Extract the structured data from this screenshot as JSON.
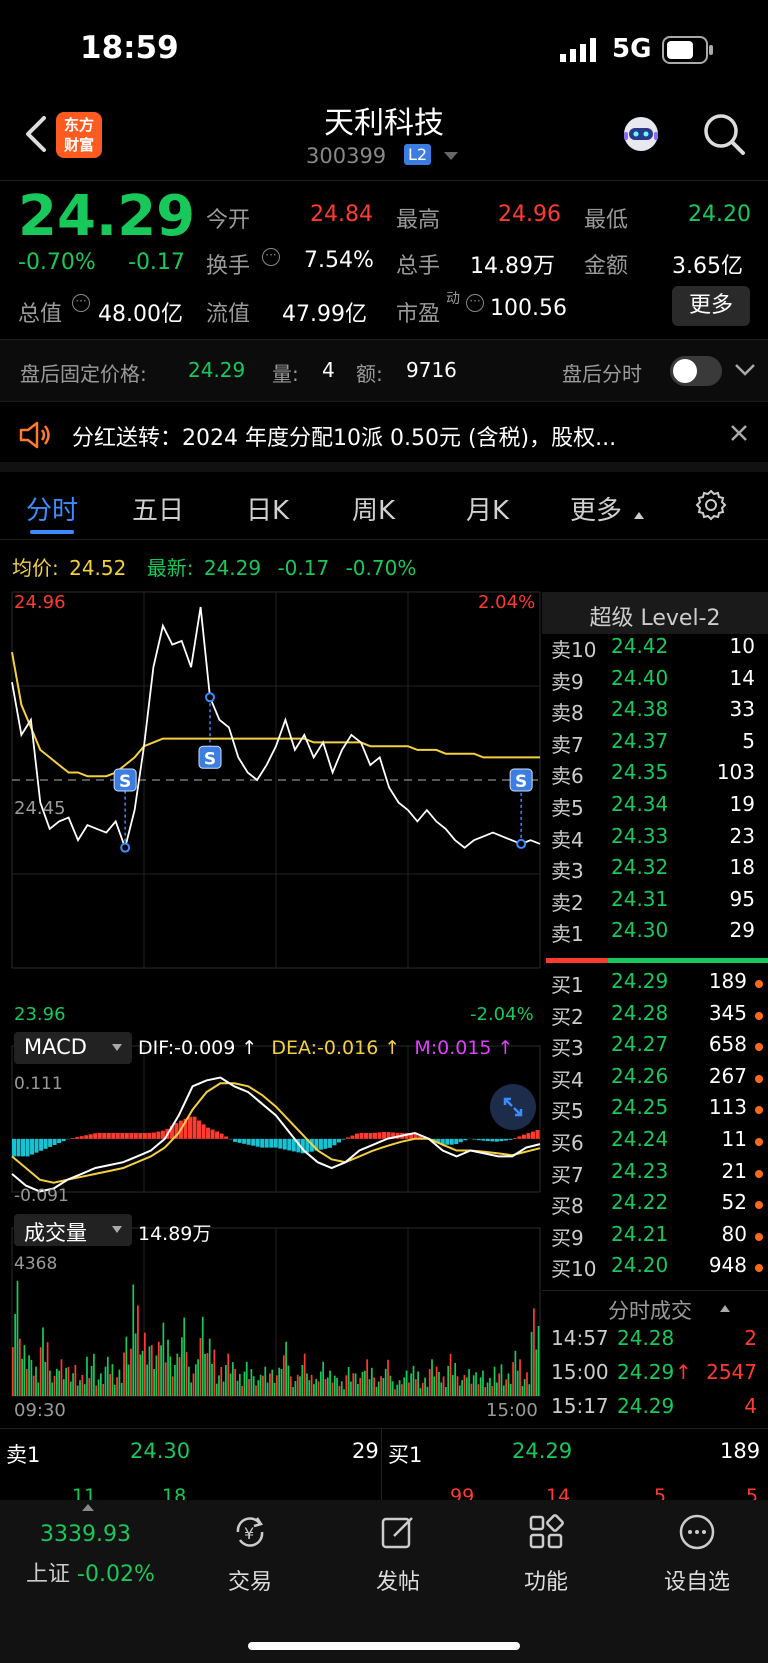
{
  "status": {
    "time": "18:59",
    "network": "5G"
  },
  "header": {
    "title": "天利科技",
    "code": "300399",
    "level_badge": "L2",
    "logo_line1": "东方",
    "logo_line2": "财富"
  },
  "quote": {
    "price": "24.29",
    "change_pct": "-0.70%",
    "change": "-0.17",
    "open_label": "今开",
    "open": "24.84",
    "high_label": "最高",
    "high": "24.96",
    "low_label": "最低",
    "low": "24.20",
    "turnover_label": "换手",
    "turnover": "7.54%",
    "volume_label": "总手",
    "volume": "14.89万",
    "amount_label": "金额",
    "amount": "3.65亿",
    "total_mv_label": "总值",
    "total_mv": "48.00亿",
    "float_mv_label": "流值",
    "float_mv": "47.99亿",
    "pe_label": "市盈",
    "pe_sup": "动",
    "pe": "100.56",
    "more_button": "更多"
  },
  "after_hours": {
    "label": "盘后固定价格:",
    "price": "24.29",
    "vol_label": "量:",
    "vol": "4",
    "amt_label": "额:",
    "amt": "9716",
    "toggle_label": "盘后分时",
    "toggle_on": false
  },
  "notice": {
    "text": "分红送转：2024 年度分配10派 0.50元 (含税)，股权..."
  },
  "tabs": [
    "分时",
    "五日",
    "日K",
    "周K",
    "月K",
    "更多"
  ],
  "active_tab": 0,
  "chart_header": {
    "avg_label": "均价:",
    "avg": "24.52",
    "latest_label": "最新:",
    "latest": "24.29",
    "chg": "-0.17",
    "chg_pct": "-0.70%"
  },
  "chart_labels": {
    "top_price": "24.96",
    "bottom_price": "23.96",
    "mid_price": "24.45",
    "top_pct": "2.04%",
    "bottom_pct": "-2.04%"
  },
  "macd": {
    "name": "MACD",
    "dif": "DIF:-0.009 ↑",
    "dea": "DEA:-0.016 ↑",
    "m": "M:0.015 ↑",
    "top": "0.111",
    "bottom": "-0.091"
  },
  "volume_panel": {
    "name": "成交量",
    "total": "14.89万",
    "max": "4368",
    "start_time": "09:30",
    "end_time": "15:00"
  },
  "colors": {
    "up": "#ff3b30",
    "down": "#18c85a",
    "avg_line": "#f4d03f",
    "price_line": "#ffffff",
    "macd_bar_down": "#17c3d3",
    "dea": "#f4d03f",
    "m": "#e040fb",
    "accent": "#3b8dff"
  },
  "chart_data": {
    "type": "line",
    "title": "",
    "x_range": [
      "09:30",
      "15:00"
    ],
    "ylim": [
      23.96,
      24.96
    ],
    "base_price": 24.46,
    "series": [
      {
        "name": "最新",
        "values": [
          24.72,
          24.58,
          24.62,
          24.4,
          24.33,
          24.35,
          24.36,
          24.3,
          24.34,
          24.33,
          24.32,
          24.35,
          24.28,
          24.38,
          24.55,
          24.76,
          24.87,
          24.82,
          24.83,
          24.76,
          24.92,
          24.68,
          24.62,
          24.6,
          24.52,
          24.48,
          24.46,
          24.5,
          24.55,
          24.62,
          24.54,
          24.58,
          24.52,
          24.56,
          24.48,
          24.54,
          24.58,
          24.56,
          24.5,
          24.52,
          24.44,
          24.4,
          24.38,
          24.35,
          24.38,
          24.35,
          24.33,
          24.3,
          24.28,
          24.3,
          24.31,
          24.32,
          24.31,
          24.3,
          24.29,
          24.3,
          24.29
        ]
      },
      {
        "name": "均价",
        "values": [
          24.8,
          24.66,
          24.6,
          24.54,
          24.52,
          24.5,
          24.48,
          24.48,
          24.47,
          24.47,
          24.47,
          24.48,
          24.5,
          24.52,
          24.55,
          24.56,
          24.57,
          24.57,
          24.57,
          24.57,
          24.57,
          24.57,
          24.57,
          24.57,
          24.57,
          24.57,
          24.57,
          24.57,
          24.57,
          24.57,
          24.57,
          24.57,
          24.56,
          24.56,
          24.56,
          24.56,
          24.56,
          24.56,
          24.55,
          24.55,
          24.55,
          24.55,
          24.55,
          24.54,
          24.54,
          24.54,
          24.53,
          24.53,
          24.53,
          24.53,
          24.52,
          24.52,
          24.52,
          24.52,
          24.52,
          24.52,
          24.52
        ]
      }
    ],
    "macd": {
      "ylim": [
        -0.091,
        0.111
      ],
      "dif": [
        -0.06,
        -0.08,
        -0.09,
        -0.085,
        -0.07,
        -0.06,
        -0.05,
        -0.045,
        -0.04,
        -0.03,
        -0.02,
        0.0,
        0.04,
        0.09,
        0.1,
        0.105,
        0.09,
        0.08,
        0.06,
        0.04,
        0.01,
        -0.02,
        -0.04,
        -0.05,
        -0.04,
        -0.02,
        -0.01,
        0.0,
        0.005,
        0.01,
        0.0,
        -0.02,
        -0.03,
        -0.02,
        -0.025,
        -0.03,
        -0.03,
        -0.015,
        -0.009
      ],
      "dea": [
        -0.03,
        -0.05,
        -0.07,
        -0.075,
        -0.07,
        -0.065,
        -0.06,
        -0.055,
        -0.05,
        -0.04,
        -0.03,
        -0.015,
        0.01,
        0.05,
        0.08,
        0.095,
        0.095,
        0.09,
        0.075,
        0.055,
        0.03,
        0.005,
        -0.02,
        -0.035,
        -0.04,
        -0.03,
        -0.02,
        -0.012,
        -0.005,
        0.0,
        0.0,
        -0.01,
        -0.02,
        -0.02,
        -0.022,
        -0.025,
        -0.028,
        -0.022,
        -0.016
      ],
      "hist": [
        -0.03,
        -0.03,
        -0.02,
        -0.01,
        0.0,
        0.005,
        0.01,
        0.01,
        0.01,
        0.01,
        0.01,
        0.015,
        0.03,
        0.04,
        0.02,
        0.01,
        -0.005,
        -0.01,
        -0.015,
        -0.015,
        -0.02,
        -0.025,
        -0.02,
        -0.015,
        0.0,
        0.01,
        0.01,
        0.012,
        0.01,
        0.01,
        0.0,
        -0.01,
        -0.01,
        0.0,
        -0.003,
        -0.005,
        -0.002,
        0.007,
        0.015
      ]
    },
    "volume": {
      "max": 4368,
      "values": [
        4368,
        1800,
        1200,
        2600,
        900,
        1500,
        1100,
        700,
        1600,
        800,
        1300,
        1000,
        2100,
        3700,
        2400,
        1800,
        3000,
        1500,
        2600,
        1200,
        2800,
        1900,
        1100,
        1500,
        900,
        1300,
        700,
        1200,
        1000,
        1800,
        800,
        1500,
        700,
        1300,
        900,
        600,
        1100,
        800,
        1500,
        700,
        1200,
        600,
        900,
        1000,
        700,
        1300,
        800,
        1600,
        700,
        1100,
        900,
        600,
        1200,
        800,
        1500,
        900,
        3100
      ]
    }
  },
  "orderbook": {
    "title": "超级 Level-2",
    "asks": [
      {
        "label": "卖10",
        "price": "24.42",
        "vol": "10"
      },
      {
        "label": "卖9",
        "price": "24.40",
        "vol": "14"
      },
      {
        "label": "卖8",
        "price": "24.38",
        "vol": "33"
      },
      {
        "label": "卖7",
        "price": "24.37",
        "vol": "5"
      },
      {
        "label": "卖6",
        "price": "24.35",
        "vol": "103"
      },
      {
        "label": "卖5",
        "price": "24.34",
        "vol": "19"
      },
      {
        "label": "卖4",
        "price": "24.33",
        "vol": "23"
      },
      {
        "label": "卖3",
        "price": "24.32",
        "vol": "18"
      },
      {
        "label": "卖2",
        "price": "24.31",
        "vol": "95"
      },
      {
        "label": "卖1",
        "price": "24.30",
        "vol": "29"
      }
    ],
    "bids": [
      {
        "label": "买1",
        "price": "24.29",
        "vol": "189"
      },
      {
        "label": "买2",
        "price": "24.28",
        "vol": "345"
      },
      {
        "label": "买3",
        "price": "24.27",
        "vol": "658"
      },
      {
        "label": "买4",
        "price": "24.26",
        "vol": "267"
      },
      {
        "label": "买5",
        "price": "24.25",
        "vol": "113"
      },
      {
        "label": "买6",
        "price": "24.24",
        "vol": "11"
      },
      {
        "label": "买7",
        "price": "24.23",
        "vol": "21"
      },
      {
        "label": "买8",
        "price": "24.22",
        "vol": "52"
      },
      {
        "label": "买9",
        "price": "24.21",
        "vol": "80"
      },
      {
        "label": "买10",
        "price": "24.20",
        "vol": "948"
      }
    ],
    "ticks_title": "分时成交",
    "ticks": [
      {
        "time": "14:57",
        "price": "24.28",
        "vol": "2"
      },
      {
        "time": "15:00",
        "price": "24.29",
        "arrow": "↑",
        "vol": "2547"
      },
      {
        "time": "15:17",
        "price": "24.29",
        "vol": "4"
      }
    ]
  },
  "level1": {
    "ask_label": "卖1",
    "ask_price": "24.30",
    "ask_vol": "29",
    "bid_label": "买1",
    "bid_price": "24.29",
    "bid_vol": "189",
    "ask_queue": [
      "11",
      "18"
    ],
    "bid_queue": [
      "99",
      "14",
      "5",
      "5"
    ]
  },
  "bottom_nav": {
    "index_value": "3339.93",
    "index_name": "上证",
    "index_change": "-0.02%",
    "items": [
      "交易",
      "发帖",
      "功能",
      "设自选"
    ]
  }
}
